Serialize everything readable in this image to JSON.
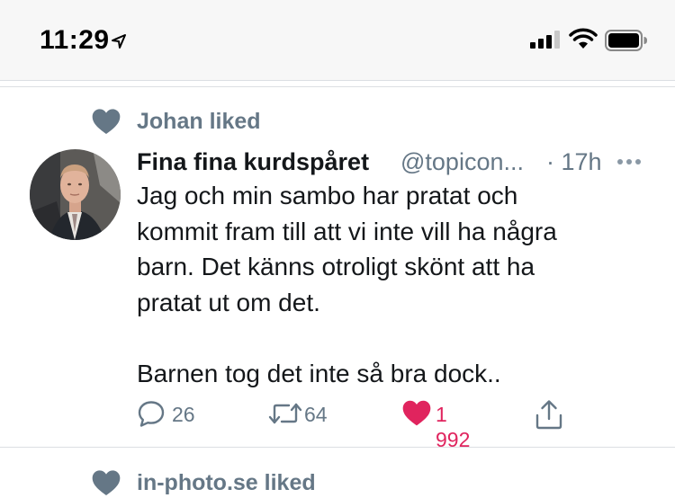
{
  "status_bar": {
    "time": "11:29",
    "icons": [
      "location-arrow-icon",
      "cellular-signal-icon",
      "wifi-icon",
      "battery-icon"
    ]
  },
  "timeline": {
    "tweet": {
      "social_context": "Johan liked",
      "author_name": "Fina fina kurdspåret",
      "author_handle": "@topicon...",
      "time": "· 17h",
      "text_lines": [
        "Jag och min sambo har pratat och",
        "kommit fram till att vi inte vill ha några",
        "barn. Det känns otroligt skönt att ha",
        "pratat ut om det.",
        "Barnen tog det inte så bra dock.."
      ],
      "actions": {
        "reply_count": "26",
        "retweet_count": "64",
        "like_count": "1 992"
      },
      "liked_by_viewer": true
    },
    "next_item": {
      "social_context": "in-photo.se liked"
    }
  },
  "colors": {
    "status_bar_bg": "#f7f7f7",
    "secondary_text": "#657786",
    "primary_text": "#14171a",
    "like_red": "#e0245e",
    "divider": "#dcdfe3"
  }
}
